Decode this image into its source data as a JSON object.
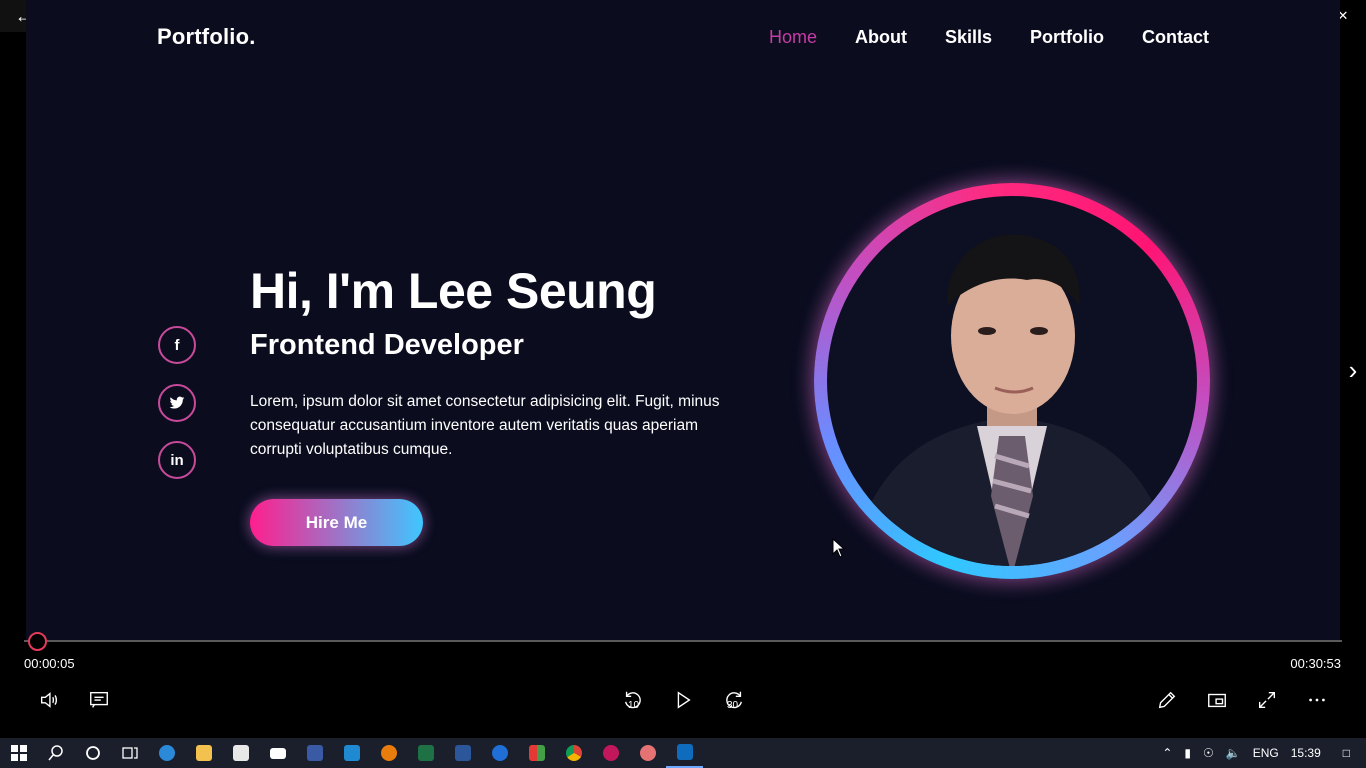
{
  "window": {
    "back_icon": "back-arrow-icon"
  },
  "page": {
    "logo": "Portfolio.",
    "nav": [
      "Home",
      "About",
      "Skills",
      "Portfolio",
      "Contact"
    ],
    "active_nav": "Home",
    "social": [
      {
        "name": "facebook",
        "glyph": "f"
      },
      {
        "name": "twitter",
        "glyph": "t"
      },
      {
        "name": "linkedin",
        "glyph": "in"
      }
    ],
    "hero": {
      "title": "Hi, I'm Lee Seung",
      "subtitle": "Frontend Developer",
      "description": "Lorem, ipsum dolor sit amet consectetur adipisicing elit. Fugit, minus consequatur accusantium inventore autem veritatis quas aperiam corrupti voluptatibus cumque.",
      "cta": "Hire Me"
    },
    "colors": {
      "accent_pink": "#ff1f8e",
      "accent_blue": "#3fc6ff",
      "background": "#0b0d1f"
    }
  },
  "player": {
    "current_time": "00:00:05",
    "total_time": "00:30:53",
    "progress": 0.003,
    "skip_back_label": "10",
    "skip_forward_label": "30"
  },
  "taskbar": {
    "tray": {
      "language": "ENG",
      "clock": "15:39"
    }
  }
}
